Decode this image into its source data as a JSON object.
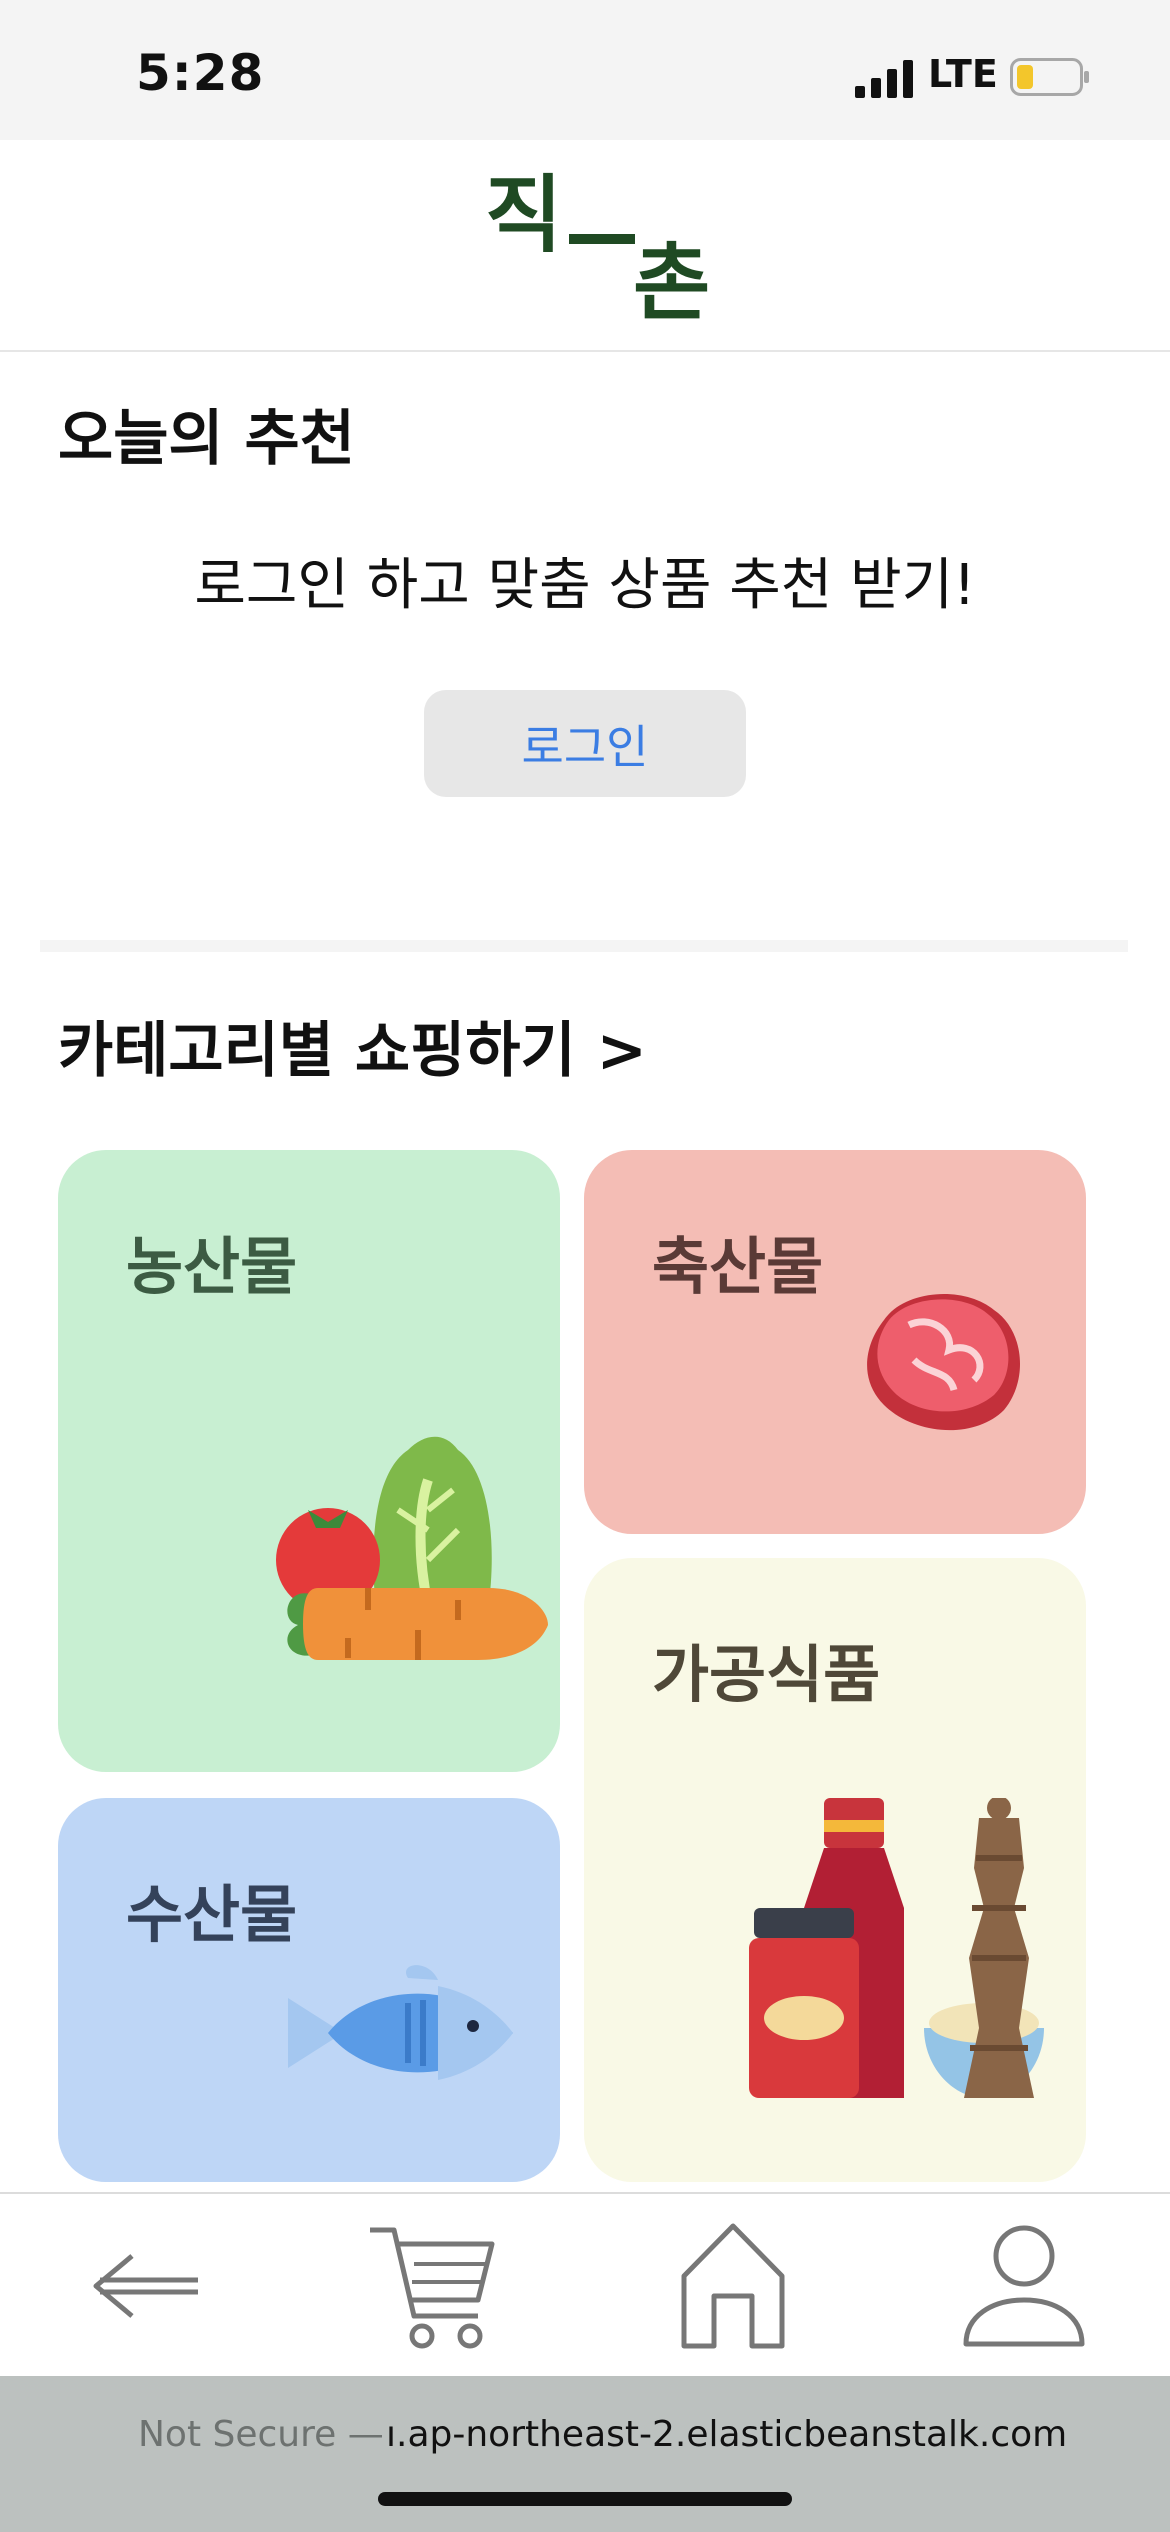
{
  "status_bar": {
    "time": "5:28",
    "network": "LTE"
  },
  "brand": {
    "logo_top": "직",
    "logo_bottom": "촌",
    "color": "#1f4a23"
  },
  "recommendation": {
    "title": "오늘의 추천",
    "message": "로그인 하고 맞춤 상품 추천 받기!",
    "login_label": "로그인"
  },
  "categories": {
    "title": "카테고리별 쇼핑하기 >",
    "items": [
      {
        "label": "농산물",
        "icon": "vegetables-icon",
        "bg": "#c8efd2"
      },
      {
        "label": "축산물",
        "icon": "meat-icon",
        "bg": "#f4bdb5"
      },
      {
        "label": "수산물",
        "icon": "fish-icon",
        "bg": "#bed6f6"
      },
      {
        "label": "가공식품",
        "icon": "processed-food-icon",
        "bg": "#f9f9e6"
      }
    ]
  },
  "tab_bar": {
    "items": [
      {
        "name": "back",
        "icon": "back-arrow-icon"
      },
      {
        "name": "cart",
        "icon": "cart-icon"
      },
      {
        "name": "home",
        "icon": "home-icon"
      },
      {
        "name": "profile",
        "icon": "profile-icon"
      }
    ]
  },
  "url_bar": {
    "not_secure": "Not Secure —",
    "host": "ı.ap-northeast-2.elasticbeanstalk.com"
  }
}
